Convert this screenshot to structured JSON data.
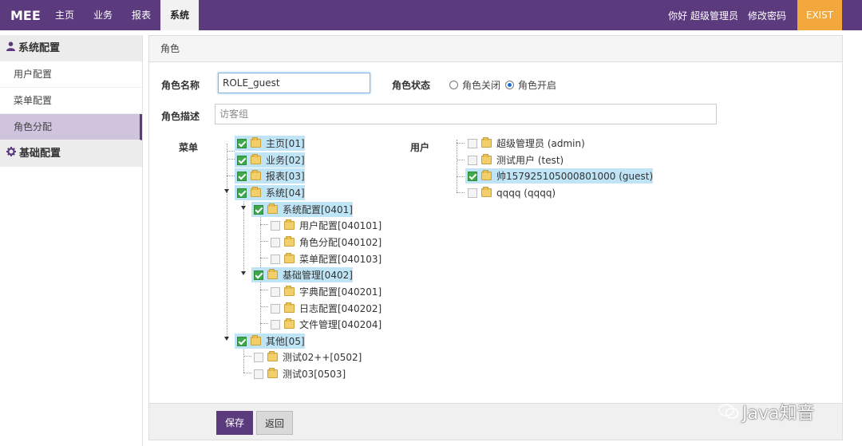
{
  "topbar": {
    "brand": "MEE",
    "nav": [
      "主页",
      "业务",
      "报表",
      "系统"
    ],
    "greeting": "你好 超级管理员",
    "change_password": "修改密码",
    "exist": "EXIST",
    "color": "#5b3b7e",
    "exist_color": "#f2a83c"
  },
  "sidebar": {
    "groups": [
      {
        "label": "系统配置",
        "icon": "user-icon",
        "items": [
          "用户配置",
          "菜单配置",
          "角色分配"
        ],
        "active": "角色分配"
      },
      {
        "label": "基础配置",
        "icon": "gear-icon",
        "items": []
      }
    ]
  },
  "panel": {
    "title": "角色",
    "role_name_label": "角色名称",
    "role_name_value": "ROLE_guest",
    "role_status_label": "角色状态",
    "status_off": "角色关闭",
    "status_on": "角色开启",
    "status_selected": "角色开启",
    "role_desc_label": "角色描述",
    "role_desc_placeholder": "访客组",
    "menu_label": "菜单",
    "user_label": "用户",
    "save": "保存",
    "back": "返回"
  },
  "menu_tree": [
    {
      "text": "主页[01]",
      "checked": true,
      "level": 0
    },
    {
      "text": "业务[02]",
      "checked": true,
      "level": 0
    },
    {
      "text": "报表[03]",
      "checked": true,
      "level": 0
    },
    {
      "text": "系统[04]",
      "checked": true,
      "level": 0
    },
    {
      "text": "系统配置[0401]",
      "checked": true,
      "level": 1
    },
    {
      "text": "用户配置[040101]",
      "checked": false,
      "level": 2
    },
    {
      "text": "角色分配[040102]",
      "checked": false,
      "level": 2
    },
    {
      "text": "菜单配置[040103]",
      "checked": false,
      "level": 2
    },
    {
      "text": "基础管理[0402]",
      "checked": true,
      "level": 1
    },
    {
      "text": "字典配置[040201]",
      "checked": false,
      "level": 2
    },
    {
      "text": "日志配置[040202]",
      "checked": false,
      "level": 2
    },
    {
      "text": "文件管理[040204]",
      "checked": false,
      "level": 2
    },
    {
      "text": "其他[05]",
      "checked": true,
      "level": 0
    },
    {
      "text": "测试02++[0502]",
      "checked": false,
      "level": 1
    },
    {
      "text": "测试03[0503]",
      "checked": false,
      "level": 1
    }
  ],
  "user_tree": [
    {
      "text": "超级管理员 (admin)",
      "checked": false
    },
    {
      "text": "测试用户 (test)",
      "checked": false
    },
    {
      "text": "帅157925105000801000 (guest)",
      "checked": true
    },
    {
      "text": "qqqq (qqqq)",
      "checked": false
    }
  ],
  "watermark": "Java知音"
}
